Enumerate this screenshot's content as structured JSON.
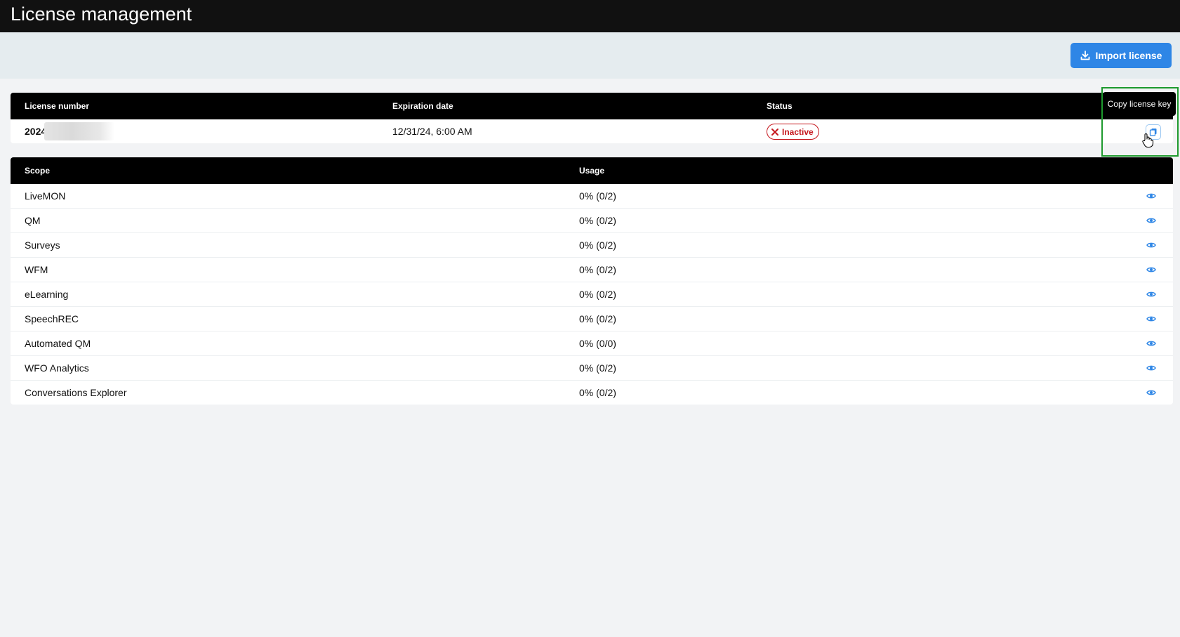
{
  "app": {
    "title": "License management"
  },
  "toolbar": {
    "import_label": "Import license",
    "import_icon": "download-icon"
  },
  "license_table": {
    "columns": [
      "License number",
      "Expiration date",
      "Status"
    ],
    "row": {
      "license_number": "2024",
      "expiration_date": "12/31/24, 6:00 AM",
      "status": "Inactive"
    },
    "copy_tooltip": "Copy license key"
  },
  "scope_table": {
    "columns": [
      "Scope",
      "Usage"
    ],
    "rows": [
      {
        "scope": "LiveMON",
        "usage": "0% (0/2)"
      },
      {
        "scope": "QM",
        "usage": "0% (0/2)"
      },
      {
        "scope": "Surveys",
        "usage": "0% (0/2)"
      },
      {
        "scope": "WFM",
        "usage": "0% (0/2)"
      },
      {
        "scope": "eLearning",
        "usage": "0% (0/2)"
      },
      {
        "scope": "SpeechREC",
        "usage": "0% (0/2)"
      },
      {
        "scope": "Automated QM",
        "usage": "0% (0/0)"
      },
      {
        "scope": "WFO Analytics",
        "usage": "0% (0/2)"
      },
      {
        "scope": "Conversations Explorer",
        "usage": "0% (0/2)"
      }
    ]
  },
  "colors": {
    "accent": "#2e86e6",
    "inactive": "#c5161c",
    "header_bg": "#000000",
    "highlight": "#1e9a2e"
  }
}
